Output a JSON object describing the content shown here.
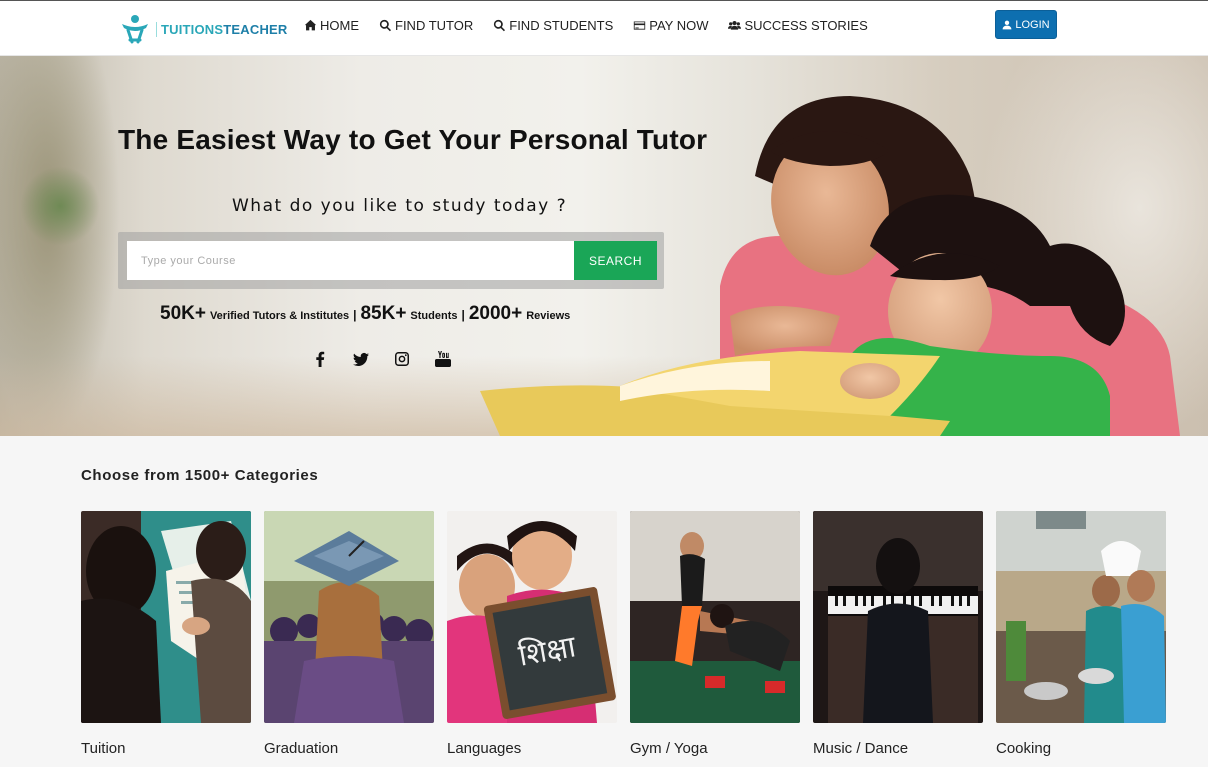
{
  "brand": {
    "part1": "TUITIONS",
    "part2": "TEACHER"
  },
  "nav": {
    "items": [
      {
        "label": "HOME",
        "icon": "home-icon"
      },
      {
        "label": "FIND TUTOR",
        "icon": "search-icon"
      },
      {
        "label": "FIND STUDENTS",
        "icon": "search-icon"
      },
      {
        "label": "PAY NOW",
        "icon": "credit-card-icon"
      },
      {
        "label": "SUCCESS STORIES",
        "icon": "users-icon"
      }
    ],
    "login_label": "LOGIN"
  },
  "hero": {
    "title": "The Easiest Way to Get Your Personal Tutor",
    "subtitle": "What do you like to study today ?",
    "search": {
      "placeholder": "Type your Course",
      "button_label": "SEARCH"
    },
    "stats": [
      {
        "value": "50K+",
        "label": "Verified Tutors & Institutes"
      },
      {
        "value": "85K+",
        "label": "Students"
      },
      {
        "value": "2000+",
        "label": "Reviews"
      }
    ],
    "socials": [
      "facebook-icon",
      "twitter-icon",
      "instagram-icon",
      "youtube-icon"
    ]
  },
  "categories": {
    "title": "Choose from 1500+ Categories",
    "items": [
      {
        "label": "Tuition"
      },
      {
        "label": "Graduation"
      },
      {
        "label": "Languages",
        "board_text": "शिक्षा"
      },
      {
        "label": "Gym / Yoga"
      },
      {
        "label": "Music / Dance"
      },
      {
        "label": "Cooking"
      }
    ]
  },
  "colors": {
    "login_bg": "#0d6fb0",
    "search_btn": "#1aa657",
    "brand_teal": "#2aa7b8"
  }
}
